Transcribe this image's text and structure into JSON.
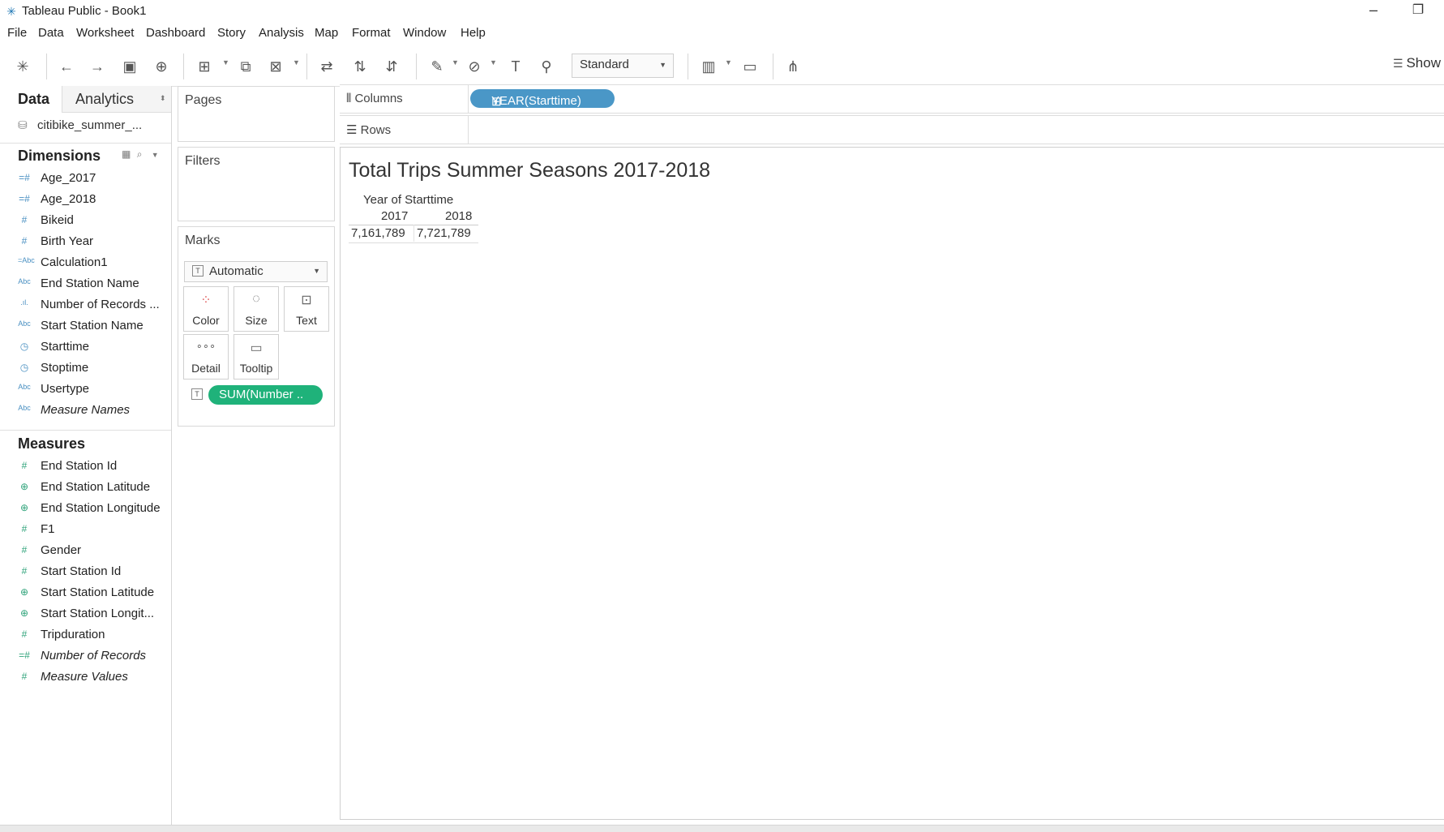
{
  "window": {
    "title": "Tableau Public - Book1"
  },
  "menu": [
    "File",
    "Data",
    "Worksheet",
    "Dashboard",
    "Story",
    "Analysis",
    "Map",
    "Format",
    "Window",
    "Help"
  ],
  "toolbar": {
    "fit": "Standard",
    "show_me": "Show"
  },
  "data_pane": {
    "tab_data": "Data",
    "tab_analytics": "Analytics",
    "datasource": "citibike_summer_...",
    "dimensions_title": "Dimensions",
    "dimensions": [
      {
        "label": "Age_2017",
        "icon": "hash-calc-icon"
      },
      {
        "label": "Age_2018",
        "icon": "hash-calc-icon"
      },
      {
        "label": "Bikeid",
        "icon": "hash-icon"
      },
      {
        "label": "Birth Year",
        "icon": "hash-icon"
      },
      {
        "label": "Calculation1",
        "icon": "abc-calc-icon"
      },
      {
        "label": "End Station Name",
        "icon": "abc-icon"
      },
      {
        "label": "Number of Records ...",
        "icon": "bin-icon"
      },
      {
        "label": "Start Station Name",
        "icon": "abc-icon"
      },
      {
        "label": "Starttime",
        "icon": "datetime-icon"
      },
      {
        "label": "Stoptime",
        "icon": "datetime-icon"
      },
      {
        "label": "Usertype",
        "icon": "abc-icon"
      },
      {
        "label": "Measure Names",
        "icon": "abc-icon"
      }
    ],
    "measures_title": "Measures",
    "measures": [
      {
        "label": "End Station Id",
        "icon": "hash-icon"
      },
      {
        "label": "End Station Latitude",
        "icon": "globe-icon"
      },
      {
        "label": "End Station Longitude",
        "icon": "globe-icon"
      },
      {
        "label": "F1",
        "icon": "hash-icon"
      },
      {
        "label": "Gender",
        "icon": "hash-icon"
      },
      {
        "label": "Start Station Id",
        "icon": "hash-icon"
      },
      {
        "label": "Start Station Latitude",
        "icon": "globe-icon"
      },
      {
        "label": "Start Station Longit...",
        "icon": "globe-icon"
      },
      {
        "label": "Tripduration",
        "icon": "hash-icon"
      },
      {
        "label": "Number of Records",
        "icon": "hash-calc-icon"
      },
      {
        "label": "Measure Values",
        "icon": "hash-icon"
      }
    ]
  },
  "cards": {
    "pages": "Pages",
    "filters": "Filters",
    "marks": "Marks",
    "marks_type": "Automatic",
    "mark_buttons": [
      "Color",
      "Size",
      "Text",
      "Detail",
      "Tooltip"
    ],
    "marks_pill": "SUM(Number .."
  },
  "shelves": {
    "columns_label": "Columns",
    "columns_pill": "YEAR(Starttime)",
    "rows_label": "Rows"
  },
  "view": {
    "title": "Total Trips Summer Seasons 2017-2018",
    "header_field": "Year of Starttime",
    "years": [
      "2017",
      "2018"
    ],
    "values": [
      "7,161,789",
      "7,721,789"
    ]
  },
  "colors": {
    "dimension_pill": "#4a97c7",
    "measure_pill": "#1fb27a"
  }
}
